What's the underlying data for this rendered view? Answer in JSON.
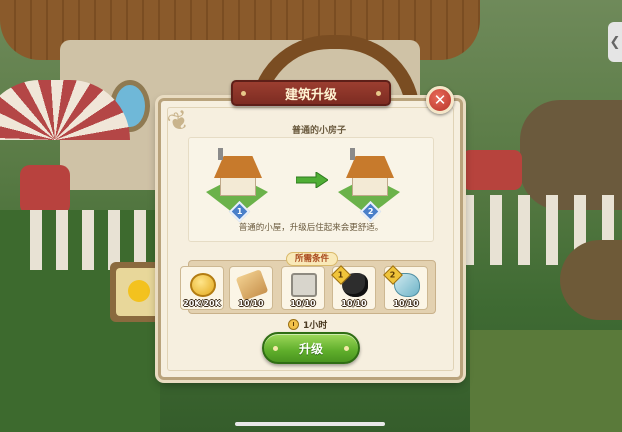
{
  "dialog": {
    "title": "建筑升级",
    "close_icon": "close-icon",
    "building_name": "普通的小房子",
    "current_level": "1",
    "next_level": "2",
    "description": "普通的小屋，升级后住起来会更舒适。",
    "requirements_label": "所需条件",
    "requirements": [
      {
        "item": "coin",
        "icon": "coin-icon",
        "count": "20K/20K"
      },
      {
        "item": "wood",
        "icon": "wood-plank-icon",
        "count": "10/10"
      },
      {
        "item": "stone",
        "icon": "stone-block-icon",
        "count": "10/10",
        "tier": ""
      },
      {
        "item": "coal",
        "icon": "coal-icon",
        "count": "10/10",
        "tier": "1"
      },
      {
        "item": "crystal",
        "icon": "crystal-ore-icon",
        "count": "10/10",
        "tier": "2"
      }
    ],
    "time": "1小时",
    "upgrade_button": "升级"
  },
  "side_tab_glyph": "❮",
  "colors": {
    "title_ribbon": "#8a3427",
    "upgrade_green": "#5fae2b",
    "close_red": "#d14b3c",
    "level_badge": "#4a7fc9",
    "arrow_green": "#4fae35"
  }
}
